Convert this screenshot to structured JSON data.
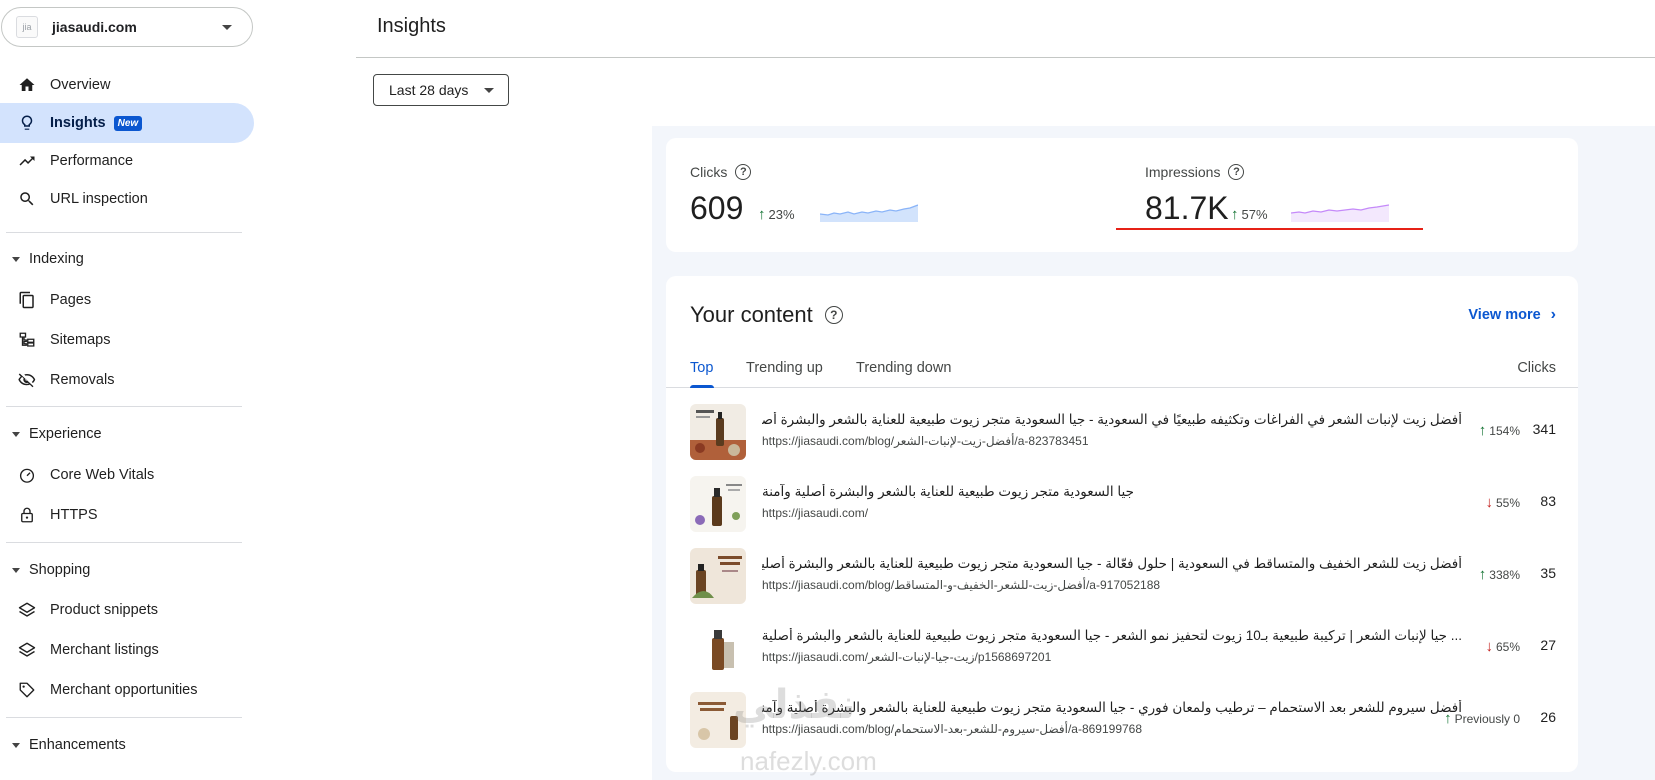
{
  "property": {
    "name": "jiasaudi.com",
    "favicon_text": "jia"
  },
  "nav": {
    "overview": "Overview",
    "insights": "Insights",
    "insights_badge": "New",
    "performance": "Performance",
    "url_inspection": "URL inspection",
    "indexing": "Indexing",
    "pages": "Pages",
    "sitemaps": "Sitemaps",
    "removals": "Removals",
    "experience": "Experience",
    "core_web_vitals": "Core Web Vitals",
    "https": "HTTPS",
    "shopping": "Shopping",
    "product_snippets": "Product snippets",
    "merchant_listings": "Merchant listings",
    "merchant_opportunities": "Merchant opportunities",
    "enhancements": "Enhancements"
  },
  "header": {
    "title": "Insights",
    "date_range": "Last 28 days"
  },
  "metrics": {
    "clicks": {
      "label": "Clicks",
      "value": "609",
      "change": "23%",
      "direction": "up",
      "spark_color": "#8ab4f8"
    },
    "impressions": {
      "label": "Impressions",
      "value": "81.7K",
      "change": "57%",
      "direction": "up",
      "spark_color": "#c58af9"
    }
  },
  "content": {
    "title": "Your content",
    "view_more": "View more",
    "tabs": [
      "Top",
      "Trending up",
      "Trending down"
    ],
    "column": "Clicks",
    "rows": [
      {
        "title": "أفضل زيت لإنبات الشعر في الفراغات وتكثيفه طبيعيًا في السعودية - جيا السعودية متجر زيوت طبيعية للعناية بالشعر والبشرة أصلية وآمنة",
        "url": "https://jiasaudi.com/blog/أفضل-زيت-لإنبات-الشعر/a-823783451",
        "change": "154%",
        "direction": "up",
        "clicks": "341"
      },
      {
        "title": "جيا السعودية متجر زيوت طبيعية للعناية بالشعر والبشرة أصلية وآمنة",
        "url": "https://jiasaudi.com/",
        "change": "55%",
        "direction": "down",
        "clicks": "83"
      },
      {
        "title": "أفضل زيت للشعر الخفيف والمتساقط في السعودية | حلول فعّالة - جيا السعودية متجر زيوت طبيعية للعناية بالشعر والبشرة أصلية وآمنة",
        "url": "https://jiasaudi.com/blog/أفضل-زيت-للشعر-الخفيف-و-المتساقط/a-917052188",
        "change": "338%",
        "direction": "up",
        "clicks": "35"
      },
      {
        "title": "... جيا لإنبات الشعر | تركيبة طبيعية بـ10 زيوت لتحفيز نمو الشعر - جيا السعودية متجر زيوت طبيعية للعناية بالشعر والبشرة أصلية وآمنة",
        "url": "https://jiasaudi.com/زيت-جيا-لإنبات-الشعر/p1568697201",
        "change": "65%",
        "direction": "down",
        "clicks": "27"
      },
      {
        "title": "أفضل سيروم للشعر بعد الاستحمام – ترطيب ولمعان فوري - جيا السعودية متجر زيوت طبيعية للعناية بالشعر والبشرة أصلية وآمنة",
        "url": "https://jiasaudi.com/blog/أفضل-سيروم-للشعر-بعد-الاستحمام/a-869199768",
        "change": "Previously 0",
        "direction": "up",
        "clicks": "26"
      }
    ]
  },
  "watermark": {
    "arabic": "نفذلي",
    "latin": "nafezly.com"
  }
}
